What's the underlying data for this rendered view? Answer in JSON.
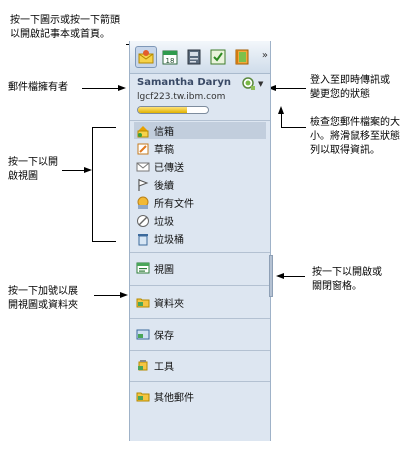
{
  "annotations": {
    "top": "按一下圖示或按一下箭頭\n以開啟記事本或首頁。",
    "owner": "郵件檔擁有者",
    "status": "登入至即時傳訊或\n變更您的狀態",
    "quota": "檢查您郵件檔案的大\n小。將滑鼠移至狀態\n列以取得資訊。",
    "open_view": "按一下以開\n啟視圖",
    "expand": "按一下加號以展\n開視圖或資料夾",
    "toggle_pane": "按一下以開啟或\n關閉窗格。"
  },
  "toolbar": {
    "buttons": [
      {
        "icon": "mail-home-icon",
        "active": true
      },
      {
        "icon": "calendar-icon",
        "label": "18"
      },
      {
        "icon": "contacts-icon"
      },
      {
        "icon": "todo-icon"
      },
      {
        "icon": "notebook-icon"
      }
    ],
    "more_glyph": "»"
  },
  "account": {
    "name": "Samantha Daryn",
    "email": "lgcf223.tw.ibm.com",
    "presence_caret": "▼",
    "quota_fraction": 0.7
  },
  "mail_views": [
    {
      "label": "信箱",
      "icon": "inbox-icon",
      "selected": true
    },
    {
      "label": "草稿",
      "icon": "drafts-icon"
    },
    {
      "label": "已傳送",
      "icon": "sent-icon"
    },
    {
      "label": "後續",
      "icon": "follow-up-icon"
    },
    {
      "label": "所有文件",
      "icon": "all-documents-icon"
    },
    {
      "label": "垃圾",
      "icon": "junk-icon"
    },
    {
      "label": "垃圾桶",
      "icon": "trash-icon"
    }
  ],
  "sections": [
    {
      "label": "視圖",
      "icon": "views-icon"
    },
    {
      "label": "資料夾",
      "icon": "folders-icon"
    },
    {
      "label": "保存",
      "icon": "archive-icon"
    },
    {
      "label": "工具",
      "icon": "tools-icon"
    },
    {
      "label": "其他郵件",
      "icon": "other-mail-icon"
    }
  ]
}
